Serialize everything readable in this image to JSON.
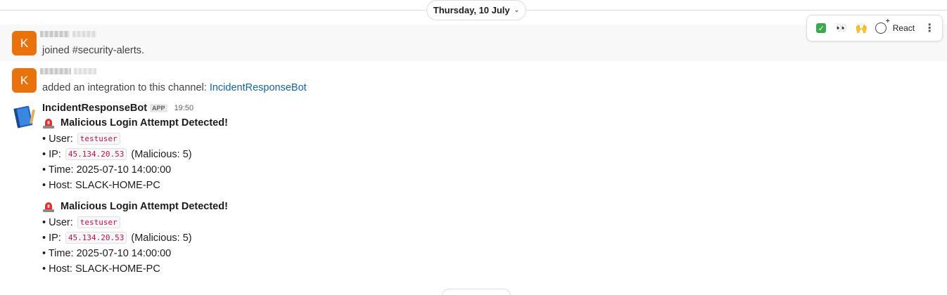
{
  "date_divider": {
    "label": "Thursday, 10 July"
  },
  "messages": [
    {
      "avatar_letter": "K",
      "text": "joined #security-alerts."
    },
    {
      "avatar_letter": "K",
      "text_prefix": "added an integration to this channel: ",
      "link": "IncidentResponseBot"
    }
  ],
  "hover_actions": {
    "emojis": [
      "white-check-mark",
      "eyes",
      "raised-hands"
    ],
    "react_label": "React",
    "more_label": "⋮"
  },
  "bot": {
    "name": "IncidentResponseBot",
    "badge": "APP",
    "time": "19:50",
    "alerts": [
      {
        "title": "Malicious Login Attempt Detected!",
        "user_label": "• User:",
        "user": "testuser",
        "ip_label": "• IP:",
        "ip": "45.134.20.53",
        "ip_suffix": "(Malicious: 5)",
        "time_label": "• Time: 2025-07-10 14:00:00",
        "host_label": "• Host: SLACK-HOME-PC"
      },
      {
        "title": "Malicious Login Attempt Detected!",
        "user_label": "• User:",
        "user": "testuser",
        "ip_label": "• IP:",
        "ip": "45.134.20.53",
        "ip_suffix": "(Malicious: 5)",
        "time_label": "• Time: 2025-07-10 14:00:00",
        "host_label": "• Host: SLACK-HOME-PC"
      }
    ]
  }
}
